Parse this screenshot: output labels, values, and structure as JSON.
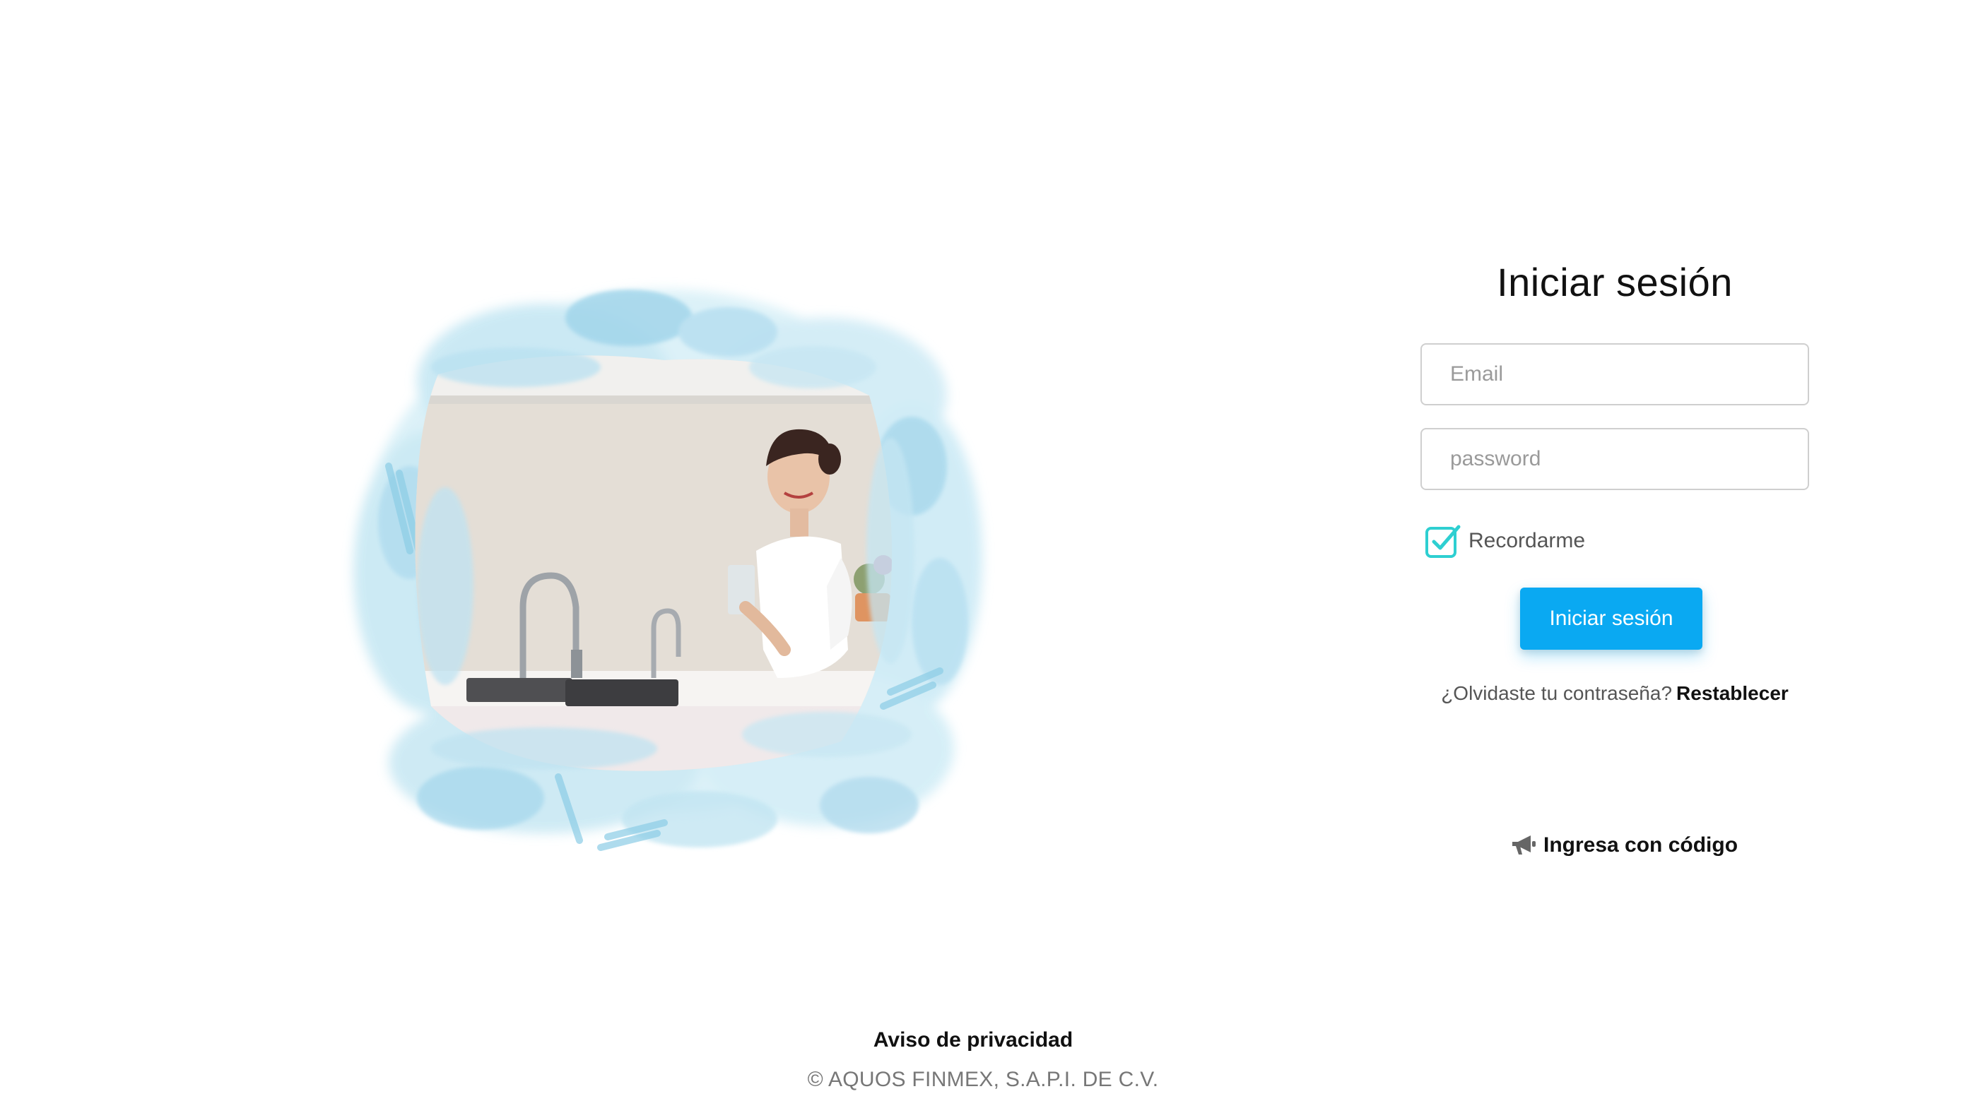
{
  "login": {
    "title": "Iniciar sesión",
    "email_placeholder": "Email",
    "password_placeholder": "password",
    "remember_label": "Recordarme",
    "remember_checked": true,
    "submit_label": "Iniciar sesión",
    "forgot_text": "¿Olvidaste tu contraseña?",
    "reset_link": "Restablecer",
    "code_link": "Ingresa con código"
  },
  "footer": {
    "privacy_link": "Aviso de privacidad",
    "copyright": "© AQUOS FINMEX, S.A.P.I. DE C.V."
  },
  "icons": {
    "checkbox": "checkbox-checked-icon",
    "code": "megaphone-icon"
  },
  "colors": {
    "accent": "#0aa9f2",
    "checkbox": "#2ecfd1",
    "watercolor": "#a9dcee"
  }
}
